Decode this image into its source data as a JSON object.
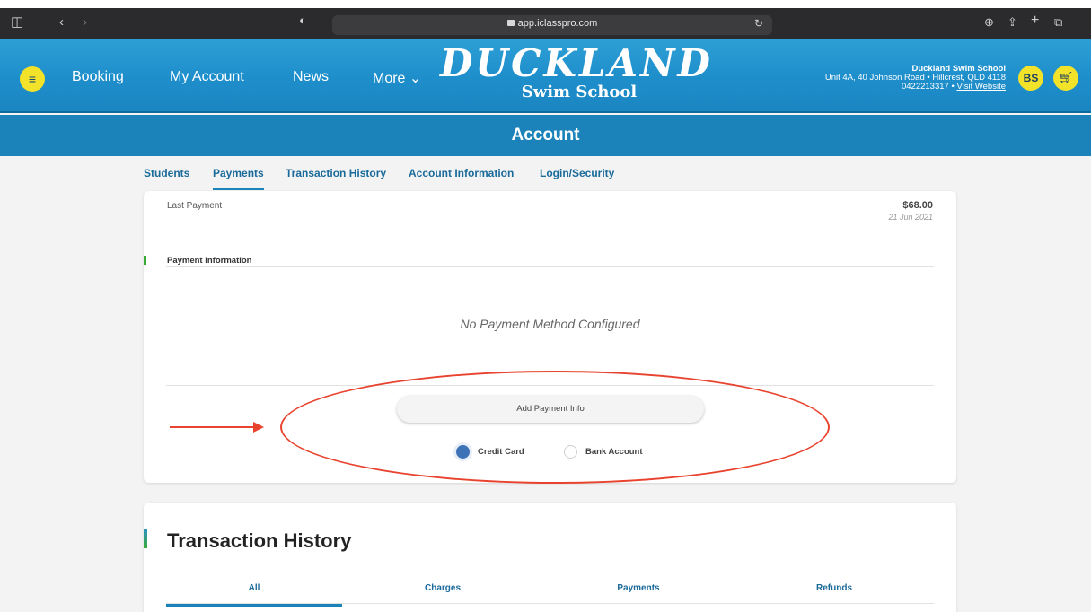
{
  "browser": {
    "url": "app.iclasspro.com"
  },
  "header": {
    "menu_icon": "hamburger-icon",
    "nav": [
      "Booking",
      "My Account",
      "News",
      "More ⌄"
    ],
    "logo_main": "DUCKLAND",
    "logo_sub": "Swim School",
    "school_name": "Duckland Swim School",
    "address": "Unit 4A, 40 Johnson Road • Hillcrest, QLD 4118",
    "phone": "0422213317 • ",
    "website_link": "Visit Website",
    "avatar_initials": "BS",
    "brand_color": "#1e8ecb",
    "accent_color": "#f2e22a"
  },
  "banner": {
    "title": "Account"
  },
  "tabs": [
    "Students",
    "Payments",
    "Transaction History",
    "Account Information",
    "Login/Security"
  ],
  "payment": {
    "last_payment_label": "Last Payment",
    "last_payment_amount": "$68.00",
    "last_payment_date": "21 Jun 2021",
    "info_label": "Payment Information",
    "no_method": "No Payment Method Configured",
    "add_button": "Add Payment Info",
    "options": [
      "Credit Card",
      "Bank Account"
    ],
    "selected_option": "Credit Card"
  },
  "transaction_history": {
    "title": "Transaction History",
    "tabs": [
      "All",
      "Charges",
      "Payments",
      "Refunds"
    ]
  }
}
